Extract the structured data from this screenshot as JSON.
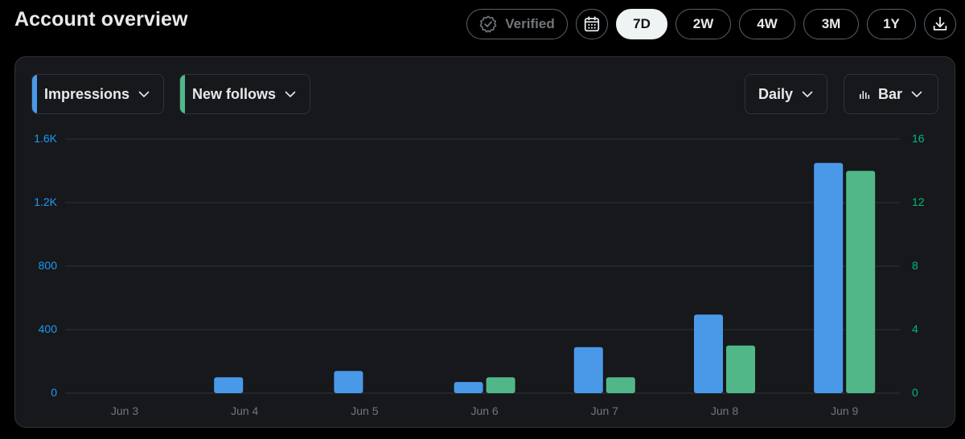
{
  "header": {
    "title": "Account overview",
    "verified_label": "Verified",
    "ranges": [
      "7D",
      "2W",
      "4W",
      "3M",
      "1Y"
    ],
    "active_range": "7D"
  },
  "controls": {
    "metric1": {
      "label": "Impressions",
      "color": "#4a99e9"
    },
    "metric2": {
      "label": "New follows",
      "color": "#52b788"
    },
    "interval": "Daily",
    "chart_type_label": "Bar"
  },
  "icons": {
    "verified": "verified-badge-icon",
    "calendar": "calendar-icon",
    "download": "download-icon",
    "chevron": "chevron-down-icon",
    "bar": "bar-chart-icon"
  },
  "chart_data": {
    "type": "bar",
    "categories": [
      "Jun 3",
      "Jun 4",
      "Jun 5",
      "Jun 6",
      "Jun 7",
      "Jun 8",
      "Jun 9"
    ],
    "series": [
      {
        "name": "Impressions",
        "axis": "left",
        "color": "#4a99e9",
        "values": [
          0,
          100,
          140,
          70,
          290,
          495,
          1450
        ]
      },
      {
        "name": "New follows",
        "axis": "right",
        "color": "#52b788",
        "values": [
          0,
          0,
          0,
          1,
          1,
          3,
          14
        ]
      }
    ],
    "y_left": {
      "ticks": [
        "0",
        "400",
        "800",
        "1.2K",
        "1.6K"
      ],
      "tick_values": [
        0,
        400,
        800,
        1200,
        1600
      ],
      "ylim": [
        0,
        1600
      ]
    },
    "y_right": {
      "ticks": [
        "0",
        "4",
        "8",
        "12",
        "16"
      ],
      "tick_values": [
        0,
        4,
        8,
        12,
        16
      ],
      "ylim": [
        0,
        16
      ]
    },
    "grid": true
  }
}
